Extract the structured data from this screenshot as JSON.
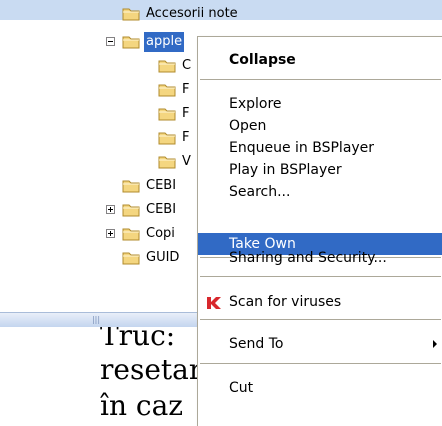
{
  "tree": {
    "items": [
      {
        "label": "Accesorii note"
      },
      {
        "label": "apple"
      },
      {
        "label": "C"
      },
      {
        "label": "F"
      },
      {
        "label": "F"
      },
      {
        "label": "F"
      },
      {
        "label": "V"
      },
      {
        "label": "CEBI"
      },
      {
        "label": "CEBI"
      },
      {
        "label": "Copi"
      },
      {
        "label": "GUID"
      }
    ]
  },
  "document": {
    "lines": [
      "Truc: ",
      "resetar",
      "în caz"
    ]
  },
  "context_menu": {
    "items": [
      {
        "label": "Collapse",
        "bold": true
      },
      {
        "label": "Explore"
      },
      {
        "label": "Open"
      },
      {
        "label": "Enqueue in BSPlayer"
      },
      {
        "label": "Play in BSPlayer"
      },
      {
        "label": "Search..."
      },
      {
        "label": "Take Own",
        "highlighted": true
      },
      {
        "label": "Sharing and Security..."
      },
      {
        "label": "Scan for viruses",
        "icon": "kaspersky-k-icon"
      },
      {
        "label": "Send To",
        "has_submenu": true
      },
      {
        "label": "Cut"
      }
    ]
  },
  "colors": {
    "selection": "#316ac5",
    "folder": "#f4d680",
    "menu_border": "#aca899"
  }
}
